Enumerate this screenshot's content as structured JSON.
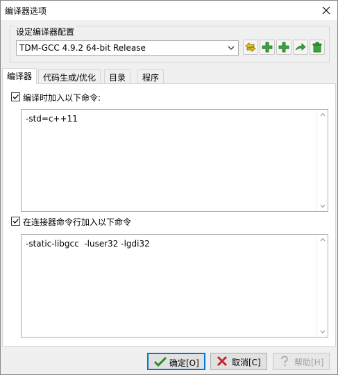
{
  "window": {
    "title": "编译器选项",
    "close_glyph": "✕"
  },
  "config_group": {
    "label": "设定编译器配置",
    "selected_compiler": "TDM-GCC 4.9.2 64-bit Release",
    "toolbar_icons": [
      "rename-icon",
      "add-icon",
      "copy-add-icon",
      "export-icon",
      "delete-icon"
    ]
  },
  "tabs": [
    {
      "label": "编译器",
      "active": true
    },
    {
      "label": "代码生成/优化",
      "active": false
    },
    {
      "label": "目录",
      "active": false
    },
    {
      "label": "程序",
      "active": false
    }
  ],
  "compiler_tab": {
    "compile_option": {
      "label": "编译时加入以下命令:",
      "checked": true,
      "value": "-std=c++11"
    },
    "linker_option": {
      "label": "在连接器命令行加入以下命令",
      "checked": true,
      "value": "-static-libgcc  -luser32 -lgdi32"
    }
  },
  "buttons": {
    "ok": "确定[O]",
    "cancel": "取消[C]",
    "help": "帮助[H]"
  },
  "colors": {
    "accent": "#0078d7",
    "check_green": "#2a8a2a",
    "cancel_red": "#c0262c",
    "icon_green": "#3aa53a",
    "icon_yellow": "#e8c21a"
  }
}
